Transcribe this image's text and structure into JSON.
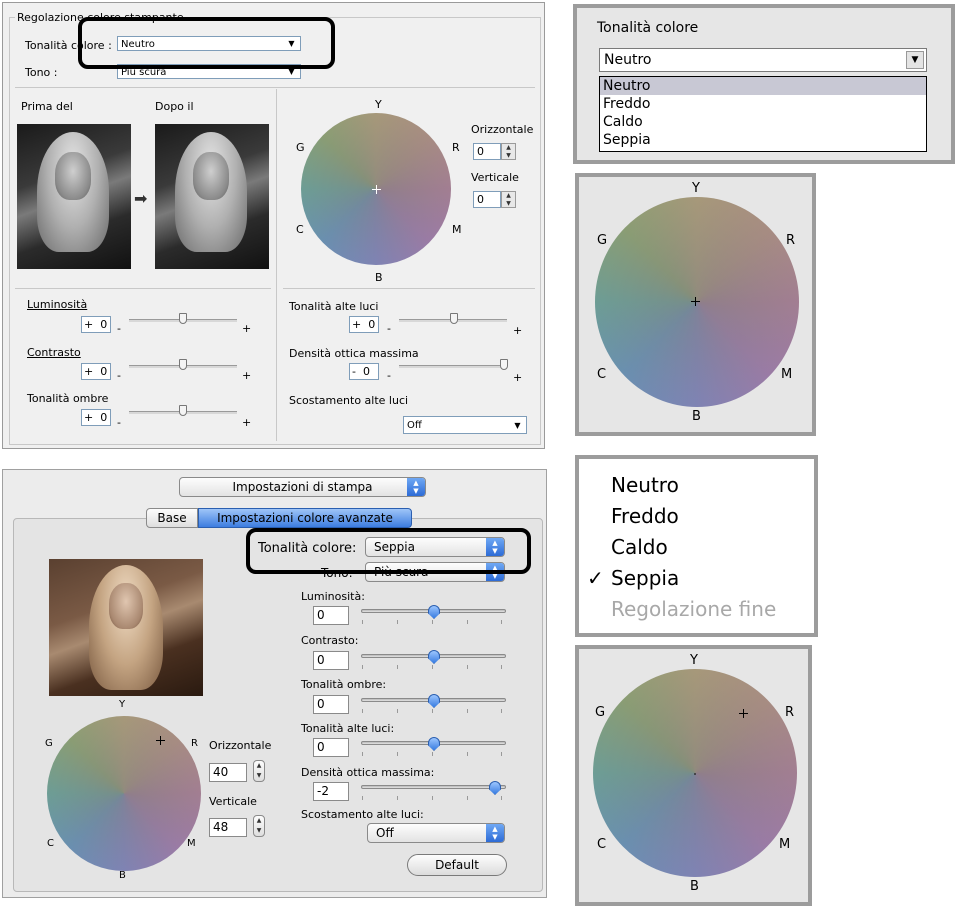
{
  "win": {
    "group_title": "Regolazione colore stampante",
    "tonality_label": "Tonalità colore :",
    "tonality_value": "Neutro",
    "tone_label": "Tono :",
    "tone_value": "Più scura",
    "before_label": "Prima del",
    "after_label": "Dopo il",
    "wheel": {
      "Y": "Y",
      "G": "G",
      "R": "R",
      "C": "C",
      "M": "M",
      "B": "B"
    },
    "horizontal_label": "Orizzontale",
    "horizontal_value": "0",
    "vertical_label": "Verticale",
    "vertical_value": "0",
    "brightness_label": "Luminosità",
    "brightness_sign": "+",
    "brightness_value": "0",
    "contrast_label": "Contrasto",
    "contrast_sign": "+",
    "contrast_value": "0",
    "shadow_label": "Tonalità ombre",
    "shadow_sign": "+",
    "shadow_value": "0",
    "highlight_label": "Tonalità alte luci",
    "highlight_sign": "+",
    "highlight_value": "0",
    "density_label": "Densità ottica massima",
    "density_sign": "-",
    "density_value": "0",
    "shift_label": "Scostamento alte luci",
    "shift_value": "Off",
    "minus": "-",
    "plus": "+"
  },
  "dropdown_win": {
    "title": "Tonalità colore",
    "value": "Neutro",
    "options": [
      "Neutro",
      "Freddo",
      "Caldo",
      "Seppia"
    ]
  },
  "wheel_neutral": {
    "Y": "Y",
    "G": "G",
    "R": "R",
    "C": "C",
    "M": "M",
    "B": "B"
  },
  "mac": {
    "panel_popup": "Impostazioni di stampa",
    "tab_basic": "Base",
    "tab_advanced": "Impostazioni colore avanzate",
    "tonality_label": "Tonalità colore:",
    "tonality_value": "Seppia",
    "tone_label": "Tono:",
    "tone_value": "Più scura",
    "brightness_label": "Luminosità:",
    "brightness_value": "0",
    "contrast_label": "Contrasto:",
    "contrast_value": "0",
    "shadow_label": "Tonalità ombre:",
    "shadow_value": "0",
    "highlight_label": "Tonalità alte luci:",
    "highlight_value": "0",
    "density_label": "Densità ottica massima:",
    "density_value": "-2",
    "shift_label": "Scostamento alte luci:",
    "shift_value": "Off",
    "horizontal_label": "Orizzontale",
    "horizontal_value": "40",
    "vertical_label": "Verticale",
    "vertical_value": "48",
    "default_button": "Default",
    "wheel": {
      "Y": "Y",
      "G": "G",
      "R": "R",
      "C": "C",
      "M": "M",
      "B": "B"
    }
  },
  "menu_mac": {
    "items": [
      "Neutro",
      "Freddo",
      "Caldo",
      "Seppia",
      "Regolazione fine"
    ],
    "checkmark": "✓"
  },
  "wheel_sepia": {
    "Y": "Y",
    "G": "G",
    "R": "R",
    "C": "C",
    "M": "M",
    "B": "B"
  },
  "colors": {
    "highlight": "#000000",
    "mac_accent": "#2d6bd6"
  }
}
